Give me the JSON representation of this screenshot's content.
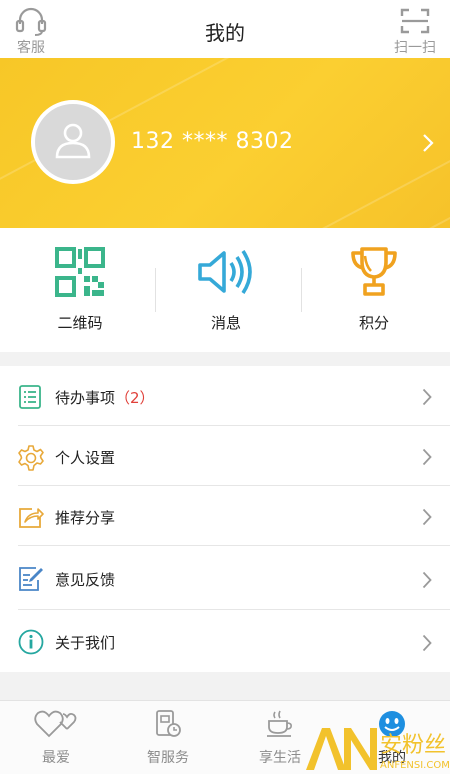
{
  "header": {
    "title": "我的",
    "left_label": "客服",
    "right_label": "扫一扫",
    "left_icon": "headset-icon",
    "right_icon": "scan-icon"
  },
  "profile": {
    "phone": "132 **** 8302",
    "background_color": "#F9C92D"
  },
  "quick_actions": [
    {
      "label": "二维码",
      "icon": "qr-code-icon",
      "color": "#3bb58b"
    },
    {
      "label": "消息",
      "icon": "speaker-icon",
      "color": "#35a9d8"
    },
    {
      "label": "积分",
      "icon": "trophy-icon",
      "color": "#f0a21f"
    }
  ],
  "menu": [
    {
      "label": "待办事项",
      "badge": "（2）",
      "icon": "checklist-icon",
      "color": "#3bb58b"
    },
    {
      "label": "个人设置",
      "badge": "",
      "icon": "gear-icon",
      "color": "#e8a93a"
    },
    {
      "label": "推荐分享",
      "badge": "",
      "icon": "share-icon",
      "color": "#e8a93a"
    },
    {
      "label": "意见反馈",
      "badge": "",
      "icon": "feedback-icon",
      "color": "#4a86c7"
    },
    {
      "label": "关于我们",
      "badge": "",
      "icon": "info-icon",
      "color": "#25a7a0"
    }
  ],
  "bottom_nav": [
    {
      "label": "最爱",
      "icon": "hearts-icon",
      "active": false
    },
    {
      "label": "智服务",
      "icon": "service-icon",
      "active": false
    },
    {
      "label": "享生活",
      "icon": "coffee-icon",
      "active": false
    },
    {
      "label": "我的",
      "icon": "smiley-icon",
      "active": true
    }
  ],
  "watermark": {
    "logo": "AN",
    "cn": "安粉丝",
    "domain": "ANFENSI.COM"
  }
}
